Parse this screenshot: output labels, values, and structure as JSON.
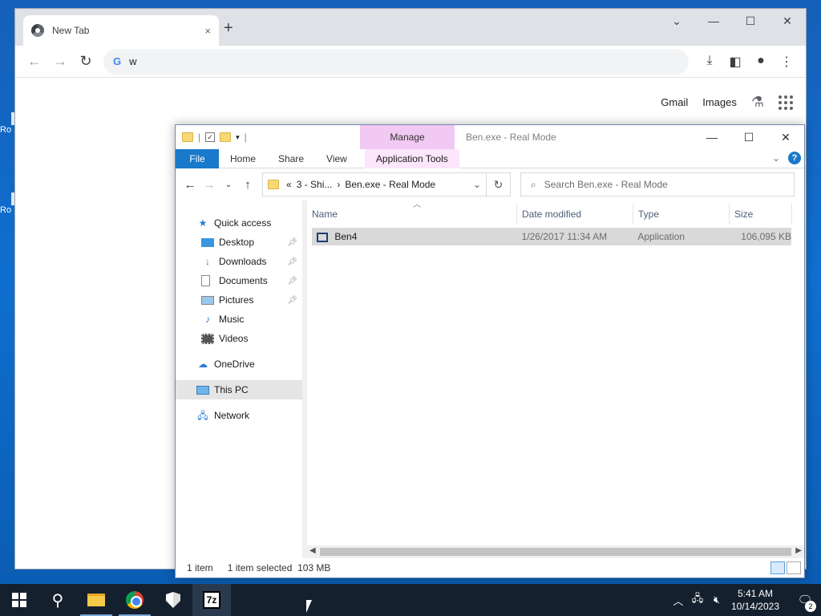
{
  "desktop": {
    "icon1_label": "Ro",
    "icon2_label": "Ro"
  },
  "chrome": {
    "tab_title": "New Tab",
    "tab_close": "×",
    "new_tab": "+",
    "omnibox_text": "w",
    "google_g": "G",
    "ntp_gmail": "Gmail",
    "ntp_images": "Images"
  },
  "explorer": {
    "manage_label": "Manage",
    "caption": "Ben.exe - Real Mode",
    "ribbon": {
      "file": "File",
      "home": "Home",
      "share": "Share",
      "view": "View",
      "app_tools": "Application Tools"
    },
    "address": {
      "prefix": "«",
      "crumb1": "3 - Shi...",
      "sep": "›",
      "crumb2": "Ben.exe - Real Mode"
    },
    "search_placeholder": "Search Ben.exe - Real Mode",
    "nav": {
      "quick_access": "Quick access",
      "desktop": "Desktop",
      "downloads": "Downloads",
      "documents": "Documents",
      "pictures": "Pictures",
      "music": "Music",
      "videos": "Videos",
      "onedrive": "OneDrive",
      "this_pc": "This PC",
      "network": "Network"
    },
    "columns": {
      "name": "Name",
      "date": "Date modified",
      "type": "Type",
      "size": "Size"
    },
    "files": [
      {
        "name": "Ben4",
        "date": "1/26/2017 11:34 AM",
        "type": "Application",
        "size": "106,095 KB"
      }
    ],
    "status": {
      "count": "1 item",
      "selected": "1 item selected",
      "size": "103 MB"
    }
  },
  "taskbar": {
    "sevenz_label": "7z",
    "time": "5:41 AM",
    "date": "10/14/2023",
    "notification_count": "2"
  }
}
